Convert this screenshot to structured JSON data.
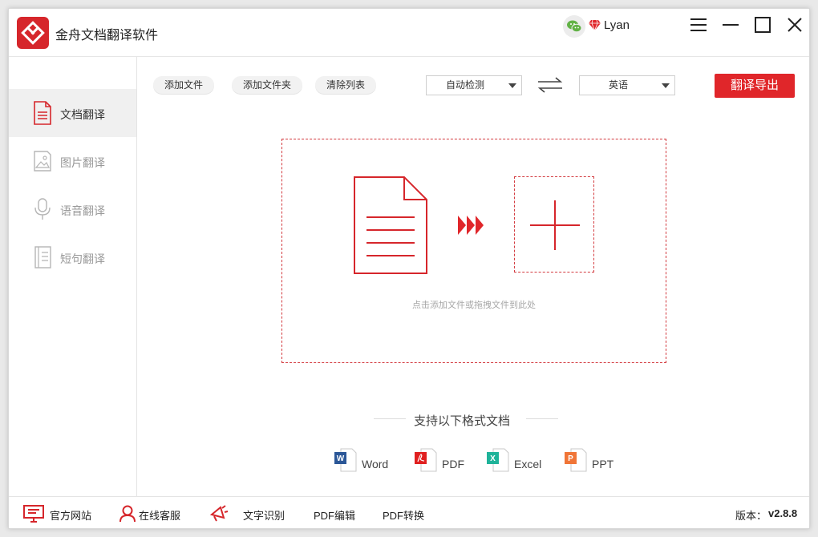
{
  "app": {
    "title": "金舟文档翻译软件",
    "user_name": "Lyan"
  },
  "colors": {
    "accent": "#e0262a",
    "dashed_border": "#d33a3f"
  },
  "sidebar": {
    "items": [
      {
        "label": "文档翻译",
        "icon": "document-icon",
        "active": true
      },
      {
        "label": "图片翻译",
        "icon": "image-icon",
        "active": false
      },
      {
        "label": "语音翻译",
        "icon": "microphone-icon",
        "active": false
      },
      {
        "label": "短句翻译",
        "icon": "notebook-icon",
        "active": false
      }
    ]
  },
  "toolbar": {
    "add_file": "添加文件",
    "add_folder": "添加文件夹",
    "clear_list": "清除列表",
    "source_lang": "自动检测",
    "target_lang": "英语",
    "export": "翻译导出"
  },
  "dropzone": {
    "hint": "点击添加文件或拖拽文件到此处"
  },
  "formats": {
    "title": "支持以下格式文档",
    "items": [
      {
        "label": "Word",
        "icon": "word-icon",
        "color": "#2b5797"
      },
      {
        "label": "PDF",
        "icon": "pdf-icon",
        "color": "#e02020"
      },
      {
        "label": "Excel",
        "icon": "excel-icon",
        "color": "#1fb39a"
      },
      {
        "label": "PPT",
        "icon": "ppt-icon",
        "color": "#f07537"
      }
    ]
  },
  "bottombar": {
    "website": "官方网站",
    "service": "在线客服",
    "ocr": "文字识别",
    "pdf_edit": "PDF编辑",
    "pdf_convert": "PDF转换",
    "version_label": "版本：",
    "version_value": "v2.8.8"
  }
}
